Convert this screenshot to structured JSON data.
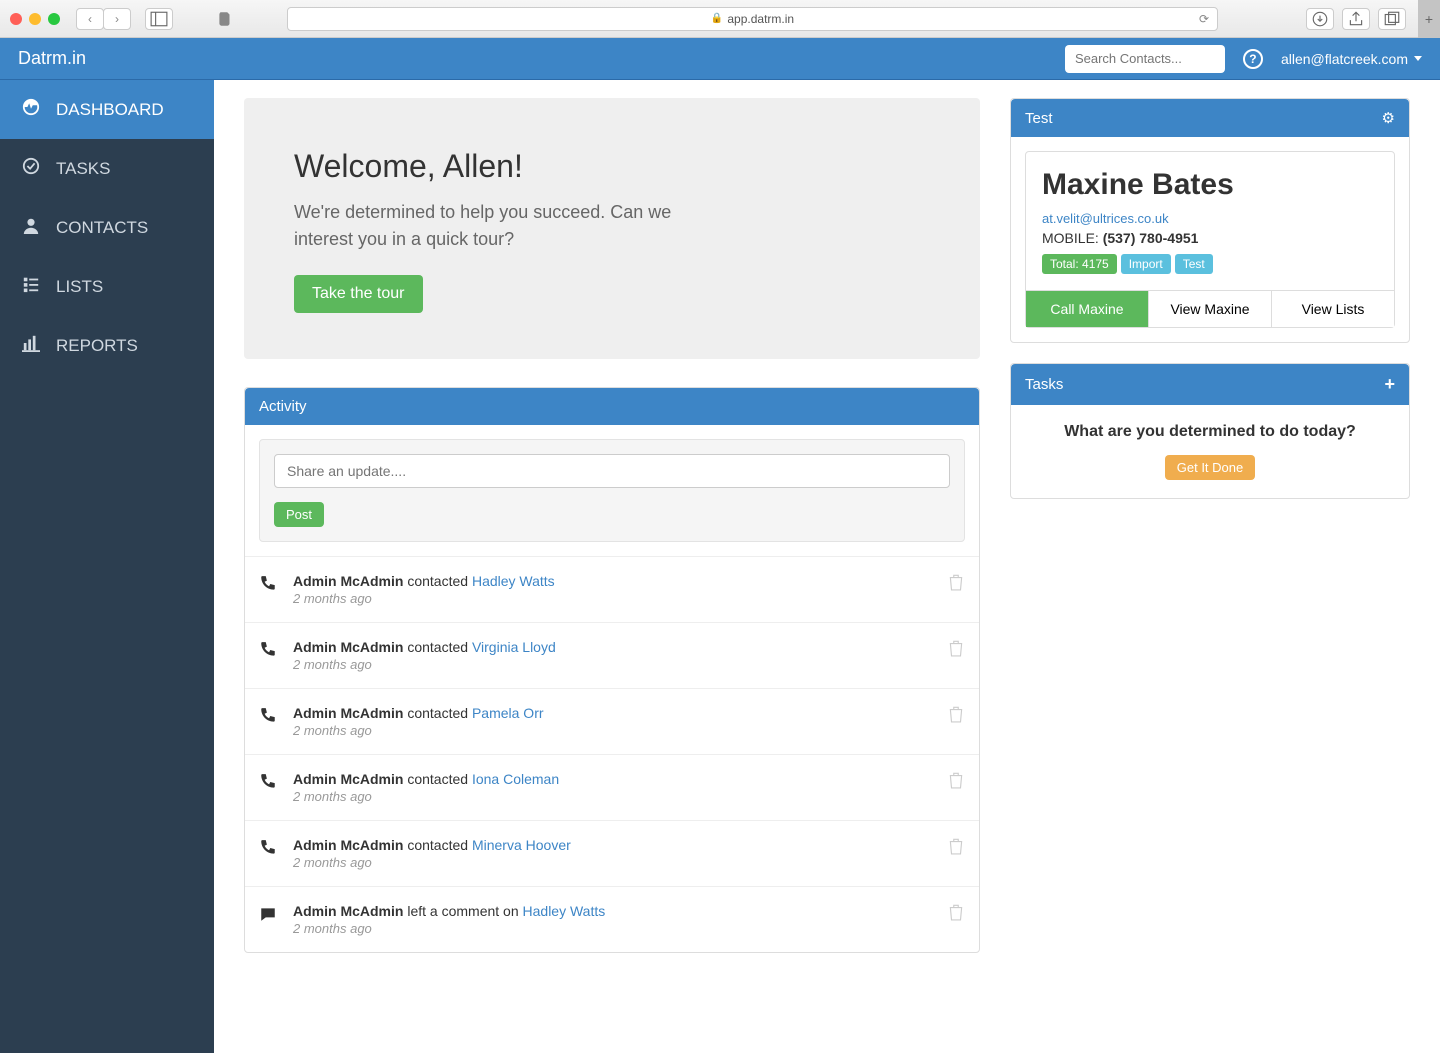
{
  "browser": {
    "url": "app.datrm.in"
  },
  "header": {
    "brand": "Datrm.in",
    "search_placeholder": "Search Contacts...",
    "user_email": "allen@flatcreek.com"
  },
  "sidebar": {
    "items": [
      {
        "label": "DASHBOARD",
        "icon": "dashboard-icon",
        "active": true
      },
      {
        "label": "TASKS",
        "icon": "check-circle-icon",
        "active": false
      },
      {
        "label": "CONTACTS",
        "icon": "user-icon",
        "active": false
      },
      {
        "label": "LISTS",
        "icon": "list-icon",
        "active": false
      },
      {
        "label": "REPORTS",
        "icon": "bar-chart-icon",
        "active": false
      }
    ]
  },
  "welcome": {
    "title": "Welcome, Allen!",
    "subtitle": "We're determined to help you succeed. Can we interest you in a quick tour?",
    "button": "Take the tour"
  },
  "activity": {
    "title": "Activity",
    "share_placeholder": "Share an update....",
    "post_label": "Post",
    "items": [
      {
        "icon": "phone-icon",
        "actor": "Admin McAdmin",
        "verb": "contacted",
        "target": "Hadley Watts",
        "time": "2 months ago"
      },
      {
        "icon": "phone-icon",
        "actor": "Admin McAdmin",
        "verb": "contacted",
        "target": "Virginia Lloyd",
        "time": "2 months ago"
      },
      {
        "icon": "phone-icon",
        "actor": "Admin McAdmin",
        "verb": "contacted",
        "target": "Pamela Orr",
        "time": "2 months ago"
      },
      {
        "icon": "phone-icon",
        "actor": "Admin McAdmin",
        "verb": "contacted",
        "target": "Iona Coleman",
        "time": "2 months ago"
      },
      {
        "icon": "phone-icon",
        "actor": "Admin McAdmin",
        "verb": "contacted",
        "target": "Minerva Hoover",
        "time": "2 months ago"
      },
      {
        "icon": "comment-icon",
        "actor": "Admin McAdmin",
        "verb": "left a comment on",
        "target": "Hadley Watts",
        "time": "2 months ago"
      }
    ]
  },
  "test_panel": {
    "title": "Test",
    "contact": {
      "name": "Maxine Bates",
      "email": "at.velit@ultrices.co.uk",
      "phone_label": "MOBILE:",
      "phone": "(537) 780-4951",
      "badges": [
        {
          "text": "Total: 4175",
          "color": "green"
        },
        {
          "text": "Import",
          "color": "blue"
        },
        {
          "text": "Test",
          "color": "blue"
        }
      ],
      "actions": {
        "call": "Call Maxine",
        "view": "View Maxine",
        "lists": "View Lists"
      }
    }
  },
  "tasks_panel": {
    "title": "Tasks",
    "prompt": "What are you determined to do today?",
    "button": "Get It Done"
  }
}
